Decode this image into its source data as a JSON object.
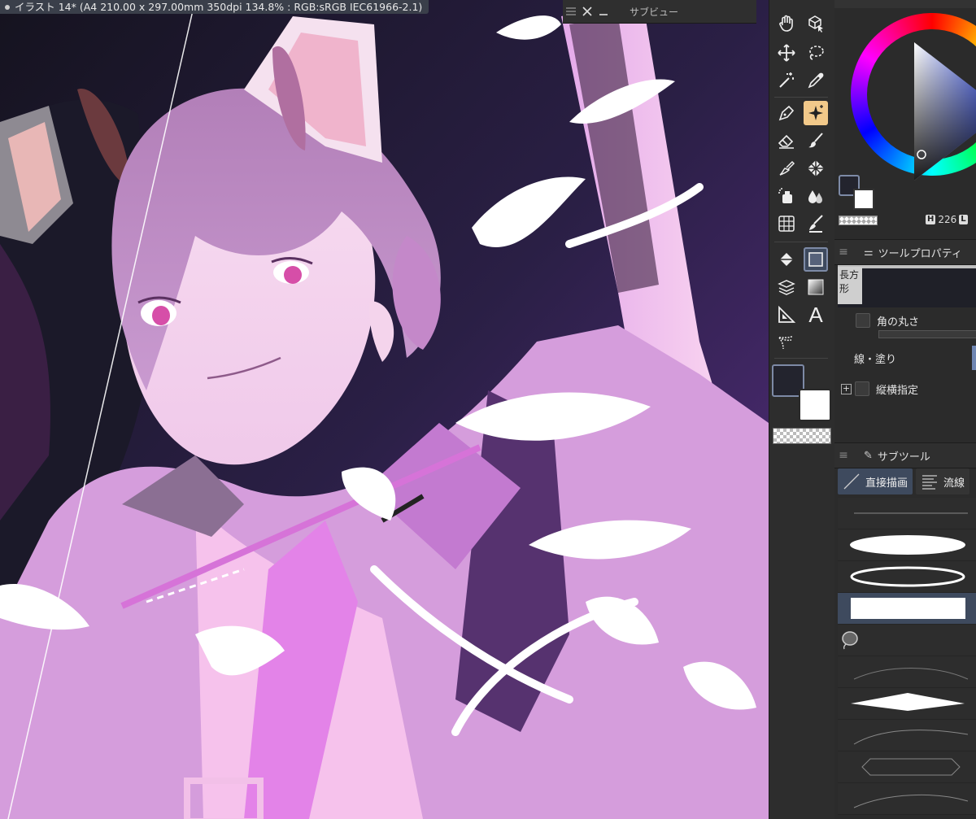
{
  "document": {
    "tab_title": "イラスト 14* (A4 210.00 x 297.00mm 350dpi 134.8% : RGB:sRGB IEC61966-2.1)"
  },
  "subview": {
    "title": "サブビュー",
    "menu_icon": "hamburger-icon",
    "close_icon": "close-icon",
    "minimize_icon": "minimize-icon"
  },
  "toolbar": {
    "tools": [
      {
        "name": "hand-tool",
        "icon": "hand-icon"
      },
      {
        "name": "rotate-3d-tool",
        "icon": "cube-cursor-icon"
      },
      {
        "name": "move-tool",
        "icon": "move-arrows-icon"
      },
      {
        "name": "lasso-tool",
        "icon": "lasso-icon"
      },
      {
        "name": "magic-wand-tool",
        "icon": "magic-wand-icon"
      },
      {
        "name": "eyedropper-tool",
        "icon": "eyedropper-icon"
      },
      {
        "name": "pen-tool",
        "icon": "pen-nib-icon"
      },
      {
        "name": "sparkle-tool",
        "icon": "sparkle-icon",
        "active": true
      },
      {
        "name": "eraser-tool",
        "icon": "eraser-icon"
      },
      {
        "name": "brush-tool",
        "icon": "brush-icon"
      },
      {
        "name": "airbrush-tool",
        "icon": "airbrush-icon"
      },
      {
        "name": "pattern-tool",
        "icon": "pattern-icon"
      },
      {
        "name": "spray-tool",
        "icon": "spray-icon"
      },
      {
        "name": "blend-tool",
        "icon": "water-drops-icon"
      },
      {
        "name": "grid-tool",
        "icon": "grid-globe-icon"
      },
      {
        "name": "fill-brush-tool",
        "icon": "fill-brush-icon"
      },
      {
        "name": "fill-tool",
        "icon": "paint-bucket-icon"
      },
      {
        "name": "figure-tool",
        "icon": "rectangle-icon",
        "selected": true
      },
      {
        "name": "layer-ruler-tool",
        "icon": "layers-icon"
      },
      {
        "name": "gradient-tool",
        "icon": "gradient-icon"
      },
      {
        "name": "frame-tool",
        "icon": "triangle-ruler-icon"
      },
      {
        "name": "text-tool",
        "icon": "text-icon",
        "label": "A"
      },
      {
        "name": "balloon-tool",
        "icon": "balloon-tail-icon"
      }
    ],
    "main_color": "#23242e",
    "sub_color": "#ffffff"
  },
  "color_panel": {
    "hue_label": "H",
    "hue_value": "226",
    "l_label": "L"
  },
  "tool_property": {
    "title": "ツールプロパティ",
    "shape_label": "長方形",
    "corner_round_label": "角の丸さ",
    "line_fill_label": "線・塗り",
    "aspect_label": "縦横指定"
  },
  "sub_tool": {
    "title": "サブツール",
    "tabs": [
      {
        "label": "直接描画",
        "icon": "line-icon",
        "active": true
      },
      {
        "label": "流線",
        "icon": "speed-lines-icon"
      }
    ],
    "brushes": [
      "thin-line",
      "filled-ellipse",
      "outlined-ellipse",
      "filled-rectangle",
      "lasso-stamp",
      "curve-line",
      "diamond",
      "curve-thin",
      "polygon-outline",
      "curve-line-2"
    ],
    "selected_index": 3
  }
}
